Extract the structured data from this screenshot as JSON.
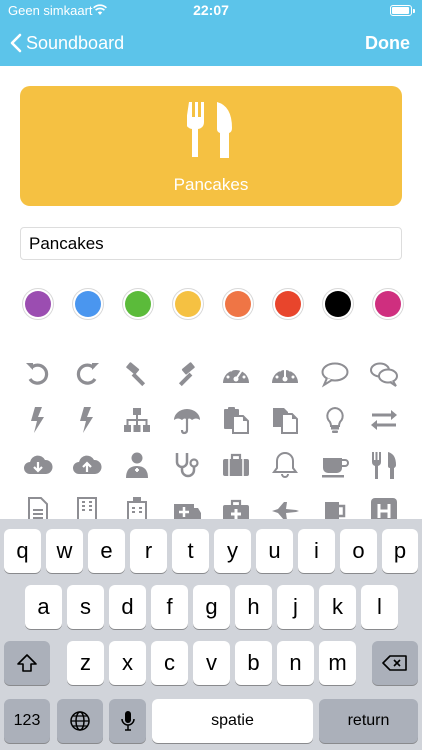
{
  "status": {
    "carrier": "Geen simkaart",
    "time": "22:07"
  },
  "nav": {
    "back_label": "Soundboard",
    "done_label": "Done"
  },
  "card": {
    "label": "Pancakes",
    "color": "#f5c142",
    "icon": "fork-knife-icon"
  },
  "name_field": {
    "value": "Pancakes"
  },
  "colors": [
    "#9b4db1",
    "#4a96ef",
    "#5bbb3a",
    "#f5c142",
    "#ef7545",
    "#e8452c",
    "#000000",
    "#cf2f7f"
  ],
  "icons": [
    [
      "undo-icon",
      "redo-icon",
      "gavel-icon",
      "gavel-alt-icon",
      "dashboard-icon",
      "dashboard-alt-icon",
      "comment-icon",
      "comments-icon"
    ],
    [
      "bolt-icon",
      "bolt-alt-icon",
      "sitemap-icon",
      "umbrella-icon",
      "paste-icon",
      "copy-icon",
      "lightbulb-icon",
      "exchange-icon"
    ],
    [
      "cloud-download-icon",
      "cloud-upload-icon",
      "user-doctor-icon",
      "stethoscope-icon",
      "suitcase-icon",
      "bell-icon",
      "coffee-icon",
      "fork-knife-icon"
    ],
    [
      "file-icon",
      "building-icon",
      "hospital-icon",
      "ambulance-icon",
      "medkit-icon",
      "fighter-jet-icon",
      "beer-icon",
      "h-square-icon"
    ]
  ],
  "keyboard": {
    "row1": [
      "q",
      "w",
      "e",
      "r",
      "t",
      "y",
      "u",
      "i",
      "o",
      "p"
    ],
    "row2": [
      "a",
      "s",
      "d",
      "f",
      "g",
      "h",
      "j",
      "k",
      "l"
    ],
    "row3": [
      "z",
      "x",
      "c",
      "v",
      "b",
      "n",
      "m"
    ],
    "numbers_label": "123",
    "space_label": "spatie",
    "return_label": "return"
  }
}
